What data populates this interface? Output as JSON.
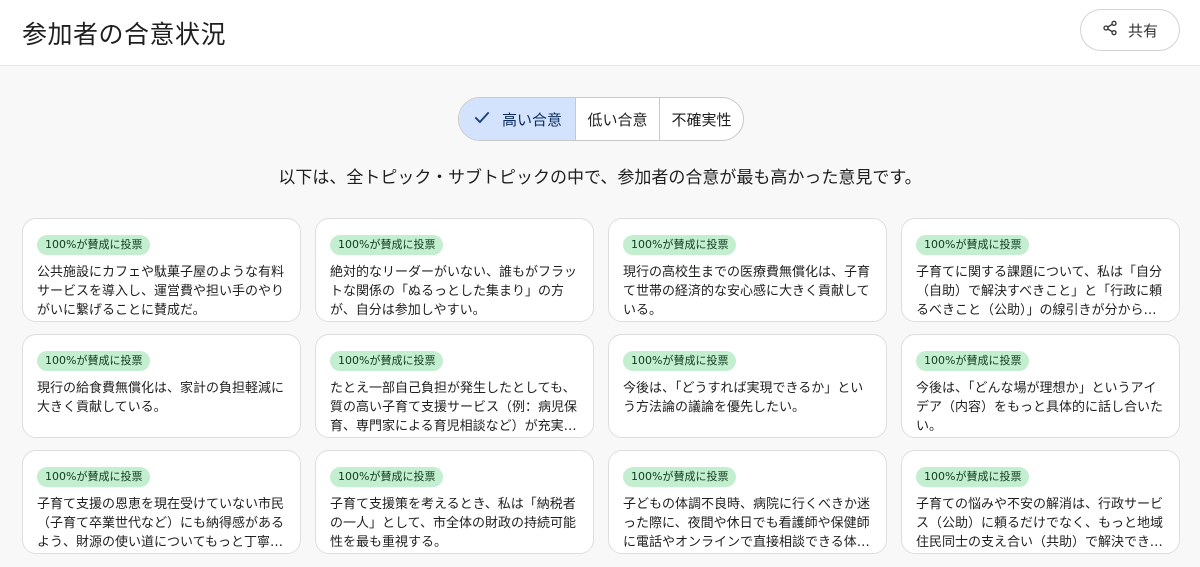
{
  "header": {
    "title": "参加者の合意状況",
    "share_label": "共有"
  },
  "filters": {
    "high": "高い合意",
    "low": "低い合意",
    "uncertain": "不確実性",
    "active": "high"
  },
  "subtitle": "以下は、全トピック・サブトピックの中で、参加者の合意が最も高かった意見です。",
  "colors": {
    "active_segment_bg": "#d3e3fd",
    "badge_bg": "#c4eed0"
  },
  "cards": [
    {
      "badge": "100%が賛成に投票",
      "text": "公共施設にカフェや駄菓子屋のような有料サービスを導入し、運営費や担い手のやりがいに繋げることに賛成だ。"
    },
    {
      "badge": "100%が賛成に投票",
      "text": "絶対的なリーダーがいない、誰もがフラットな関係の「ぬるっとした集まり」の方が、自分は参加しやすい。"
    },
    {
      "badge": "100%が賛成に投票",
      "text": "現行の高校生までの医療費無償化は、子育て世帯の経済的な安心感に大きく貢献している。"
    },
    {
      "badge": "100%が賛成に投票",
      "text": "子育てに関する課題について、私は「自分（自助）で解決すべきこと」と「行政に頼るべきこと（公助）」の線引きが分からず、悩んでいる。"
    },
    {
      "badge": "100%が賛成に投票",
      "text": "現行の給食費無償化は、家計の負担軽減に大きく貢献している。"
    },
    {
      "badge": "100%が賛成に投票",
      "text": "たとえ一部自己負担が発生したとしても、質の高い子育て支援サービス（例：病児保育、専門家による育児相談など）が充実する方が良い。"
    },
    {
      "badge": "100%が賛成に投票",
      "text": "今後は、「どうすれば実現できるか」という方法論の議論を優先したい。"
    },
    {
      "badge": "100%が賛成に投票",
      "text": "今後は、「どんな場が理想か」というアイデア（内容）をもっと具体的に話し合いたい。"
    },
    {
      "badge": "100%が賛成に投票",
      "text": "子育て支援の恩恵を現在受けていない市民（子育て卒業世代など）にも納得感があるよう、財源の使い道についてもっと丁寧な説明が必要だ。"
    },
    {
      "badge": "100%が賛成に投票",
      "text": "子育て支援策を考えるとき、私は「納税者の一人」として、市全体の財政の持続可能性を最も重視する。"
    },
    {
      "badge": "100%が賛成に投票",
      "text": "子どもの体調不良時、病院に行くべきか迷った際に、夜間や休日でも看護師や保健師に電話やオンラインで直接相談できる体制があると良い。"
    },
    {
      "badge": "100%が賛成に投票",
      "text": "子育ての悩みや不安の解消は、行政サービス（公助）に頼るだけでなく、もっと地域住民同士の支え合い（共助）で解決できる部分がある。"
    }
  ]
}
